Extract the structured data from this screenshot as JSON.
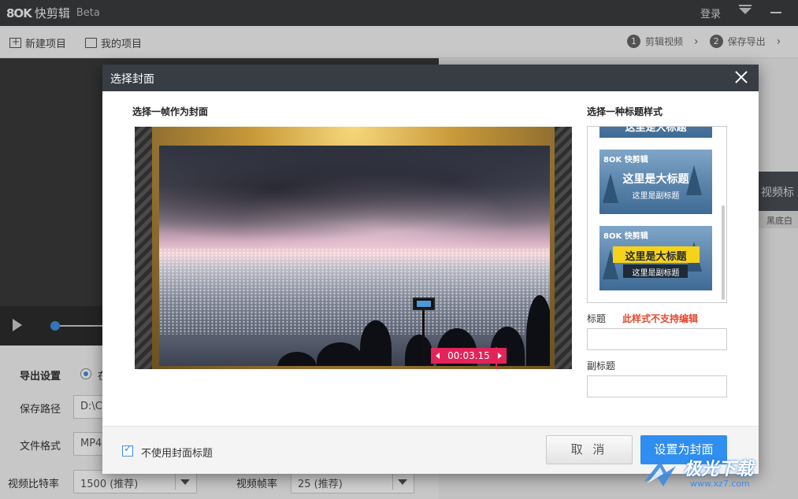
{
  "app": {
    "logo": "8OK",
    "title": "快剪辑",
    "beta": "Beta",
    "login": "登录"
  },
  "toolbar": {
    "new_project": "新建项目",
    "my_projects": "我的项目",
    "steps": [
      {
        "num": "1",
        "label": "剪辑视频"
      },
      {
        "num": "2",
        "label": "保存导出"
      }
    ]
  },
  "side_panel": {
    "tab_label": "视频标",
    "sub_label": "黑底白"
  },
  "export": {
    "section_label": "导出设置",
    "radio_label": "在",
    "save_path_label": "保存路径",
    "save_path_value": "D:\\C",
    "format_label": "文件格式",
    "format_value": "MP4",
    "bitrate_label": "视频比特率",
    "bitrate_value": "1500 (推荐)",
    "framerate_label": "视频帧率",
    "framerate_value": "25 (推荐)"
  },
  "dialog": {
    "title": "选择封面",
    "left_title": "选择一帧作为封面",
    "right_title": "选择一种标题样式",
    "timestamp": "00:03.15",
    "styles": [
      {
        "logo": "8OK 快剪辑",
        "main": "这里是大标题",
        "sub": "这里是副标题"
      },
      {
        "logo": "8OK 快剪辑",
        "main": "这里是大标题",
        "sub": "这里是副标题"
      }
    ],
    "top_cut_text": "这里是大标题",
    "title_label": "标题",
    "warning": "此样式不支持编辑",
    "subtitle_label": "副标题",
    "checkbox_label": "不使用封面标题",
    "checkbox_checked": true,
    "cancel_label": "取 消",
    "confirm_label": "设置为封面"
  },
  "watermark": {
    "text": "极光下载",
    "url": "www.xz7.com"
  },
  "colors": {
    "accent": "#2f8ef0",
    "marker": "#e2245a",
    "warning": "#e4472d",
    "header": "#383d44"
  }
}
